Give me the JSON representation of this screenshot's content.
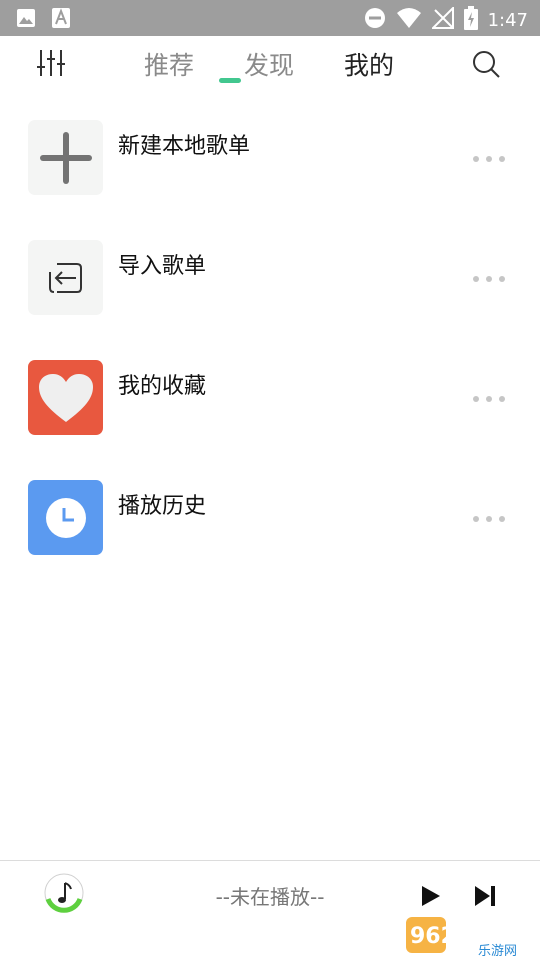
{
  "status_bar": {
    "time": "1:47",
    "icons": [
      "image-icon",
      "text-a-icon",
      "do-not-disturb-icon",
      "wifi-icon",
      "no-signal-icon",
      "battery-charging-icon"
    ]
  },
  "top_nav": {
    "tabs": [
      {
        "label": "推荐",
        "active": false
      },
      {
        "label": "发现",
        "active": false
      },
      {
        "label": "我的",
        "active": true
      }
    ],
    "accent_color": "#42c78f"
  },
  "items": [
    {
      "label": "新建本地歌单",
      "icon": "plus-icon",
      "icon_bg": "#f4f5f4"
    },
    {
      "label": "导入歌单",
      "icon": "import-icon",
      "icon_bg": "#f4f5f4"
    },
    {
      "label": "我的收藏",
      "icon": "heart-icon",
      "icon_bg": "#e8583f"
    },
    {
      "label": "播放历史",
      "icon": "clock-icon",
      "icon_bg": "#5b9af0"
    }
  ],
  "player": {
    "status_text": "--未在播放--"
  },
  "watermark": {
    "text_top": "962.NET",
    "text_bottom": "乐游网"
  }
}
